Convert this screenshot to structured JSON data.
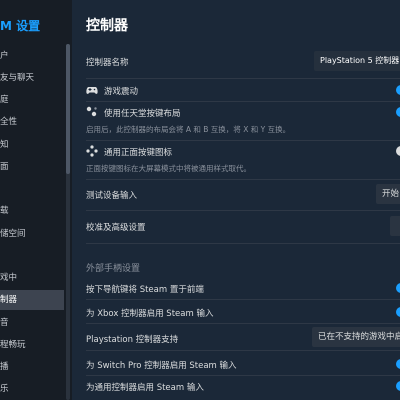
{
  "sidebar": {
    "title": "M 设置",
    "items": [
      {
        "label": "户",
        "active": false
      },
      {
        "label": "友与聊天",
        "active": false
      },
      {
        "label": "庭",
        "active": false
      },
      {
        "label": "全性",
        "active": false
      },
      {
        "label": "知",
        "active": false
      },
      {
        "label": "面",
        "active": false
      },
      {
        "label": "",
        "active": false
      },
      {
        "label": "载",
        "active": false
      },
      {
        "label": "储空间",
        "active": false
      },
      {
        "label": "",
        "active": false
      },
      {
        "label": "戏中",
        "active": false
      },
      {
        "label": "制器",
        "active": true
      },
      {
        "label": "音",
        "active": false
      },
      {
        "label": "程畅玩",
        "active": false
      },
      {
        "label": "播",
        "active": false
      },
      {
        "label": "乐",
        "active": false
      }
    ]
  },
  "main": {
    "title": "控制器",
    "controller_name_label": "控制器名称",
    "controller_name_value": "PlayStation 5 控制器",
    "rumble_label": "游戏震动",
    "nintendo_layout_label": "使用任天堂按键布局",
    "nintendo_layout_desc": "启用后，此控制器的布局会将 A 和 B 互换，将 X 和 Y 互换。",
    "universal_glyphs_label": "通用正面按键图标",
    "universal_glyphs_desc": "正面按键图标在大屏幕模式中将被通用样式取代。",
    "test_input_label": "测试设备输入",
    "test_input_button": "开始",
    "calibration_label": "校准及高级设置",
    "external_section": "外部手柄设置",
    "guide_label": "按下导航键将 Steam 置于前端",
    "xbox_label": "为 Xbox 控制器启用 Steam 输入",
    "playstation_label": "Playstation 控制器支持",
    "playstation_value": "已在不支持的游戏中启用",
    "switch_label": "为 Switch Pro 控制器启用 Steam 输入",
    "generic_label": "为通用控制器启用 Steam 输入"
  },
  "icons": {
    "rumble": "gamepad-icon",
    "nintendo": "button-layout-icon",
    "glyphs": "face-buttons-icon"
  },
  "colors": {
    "accent": "#1a9fff",
    "background": "#1b2838",
    "sidebar": "#171d25",
    "active_item": "#3d4450"
  }
}
